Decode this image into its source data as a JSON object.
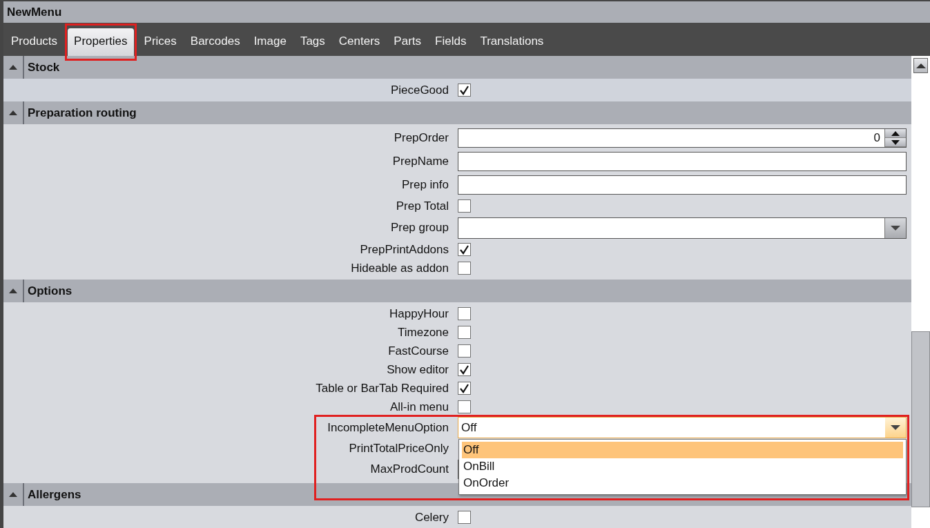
{
  "window": {
    "title": "NewMenu"
  },
  "tabs": [
    {
      "label": "Products",
      "selected": false,
      "highlighted": false
    },
    {
      "label": "Properties",
      "selected": true,
      "highlighted": true
    },
    {
      "label": "Prices",
      "selected": false,
      "highlighted": false
    },
    {
      "label": "Barcodes",
      "selected": false,
      "highlighted": false
    },
    {
      "label": "Image",
      "selected": false,
      "highlighted": false
    },
    {
      "label": "Tags",
      "selected": false,
      "highlighted": false
    },
    {
      "label": "Centers",
      "selected": false,
      "highlighted": false
    },
    {
      "label": "Parts",
      "selected": false,
      "highlighted": false
    },
    {
      "label": "Fields",
      "selected": false,
      "highlighted": false
    },
    {
      "label": "Translations",
      "selected": false,
      "highlighted": false
    }
  ],
  "sections": [
    {
      "title": "Stock",
      "expanded": true,
      "rows": [
        {
          "kind": "checkbox",
          "label": "PieceGood",
          "checked": true
        }
      ]
    },
    {
      "title": "Preparation routing",
      "expanded": true,
      "rows": [
        {
          "kind": "number",
          "label": "PrepOrder",
          "value": "0"
        },
        {
          "kind": "text",
          "label": "PrepName",
          "value": ""
        },
        {
          "kind": "text",
          "label": "Prep info",
          "value": ""
        },
        {
          "kind": "checkbox",
          "label": "Prep Total",
          "checked": false
        },
        {
          "kind": "combo",
          "label": "Prep group",
          "value": "",
          "open": false,
          "highlighted": false
        },
        {
          "kind": "checkbox",
          "label": "PrepPrintAddons",
          "checked": true
        },
        {
          "kind": "checkbox",
          "label": "Hideable as addon",
          "checked": false
        }
      ]
    },
    {
      "title": "Options",
      "expanded": true,
      "rows": [
        {
          "kind": "checkbox",
          "label": "HappyHour",
          "checked": false
        },
        {
          "kind": "checkbox",
          "label": "Timezone",
          "checked": false
        },
        {
          "kind": "checkbox",
          "label": "FastCourse",
          "checked": false
        },
        {
          "kind": "checkbox",
          "label": "Show editor",
          "checked": true
        },
        {
          "kind": "checkbox",
          "label": "Table or BarTab Required",
          "checked": true
        },
        {
          "kind": "checkbox",
          "label": "All-in menu",
          "checked": false
        },
        {
          "kind": "combo",
          "label": "IncompleteMenuOption",
          "value": "Off",
          "open": true,
          "highlighted": true,
          "options": [
            {
              "label": "Off",
              "selected": true
            },
            {
              "label": "OnBill",
              "selected": false
            },
            {
              "label": "OnOrder",
              "selected": false
            }
          ]
        },
        {
          "kind": "covered",
          "label": "PrintTotalPriceOnly"
        },
        {
          "kind": "text",
          "label": "MaxProdCount",
          "value": ""
        }
      ]
    },
    {
      "title": "Allergens",
      "expanded": true,
      "rows": [
        {
          "kind": "checkbox",
          "label": "Celery",
          "checked": false
        }
      ]
    }
  ]
}
